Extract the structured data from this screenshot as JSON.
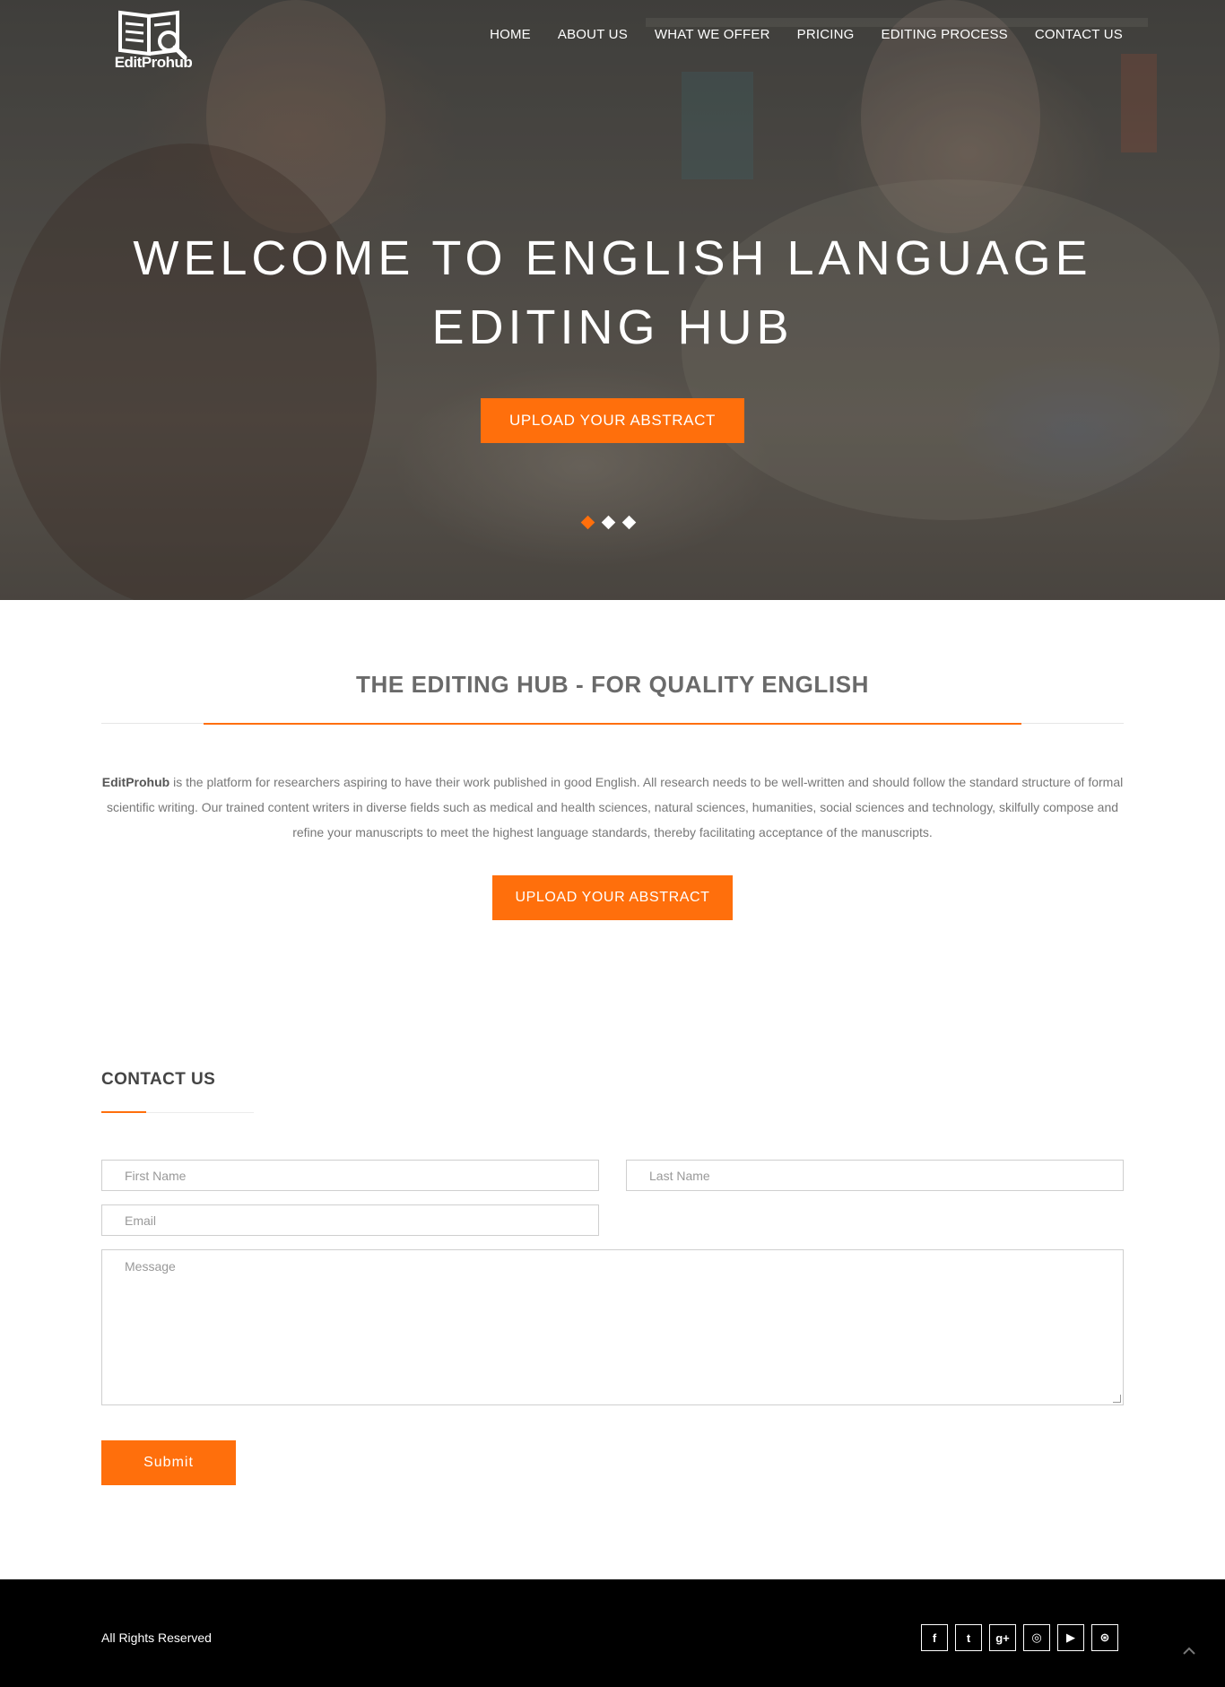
{
  "brand": {
    "name": "EditProhub"
  },
  "nav": {
    "items": [
      {
        "label": "HOME"
      },
      {
        "label": "ABOUT US"
      },
      {
        "label": "WHAT WE OFFER"
      },
      {
        "label": "PRICING"
      },
      {
        "label": "EDITING PROCESS"
      },
      {
        "label": "CONTACT US"
      }
    ]
  },
  "hero": {
    "title_line1": "WELCOME TO ENGLISH LANGUAGE",
    "title_line2": "EDITING HUB",
    "button_label": "UPLOAD YOUR ABSTRACT",
    "slides": {
      "count": 3,
      "active_index": 0
    }
  },
  "intro": {
    "title": "THE EDITING HUB - FOR QUALITY ENGLISH",
    "text_brand": "EditProhub",
    "text_body": " is the platform for researchers aspiring to have their work published in good English. All research needs to be well-written and should follow the standard structure of formal scientific writing. Our trained content writers in diverse fields such as medical and health sciences, natural sciences, humanities, social sciences and technology, skilfully compose and refine your manuscripts to meet the highest language standards, thereby facilitating acceptance of the manuscripts.",
    "button_label": "UPLOAD YOUR ABSTRACT"
  },
  "contact": {
    "title": "CONTACT US",
    "first_name_placeholder": "First Name",
    "last_name_placeholder": "Last Name",
    "email_placeholder": "Email",
    "message_placeholder": "Message",
    "submit_label": "Submit"
  },
  "footer": {
    "copyright": "All Rights Reserved",
    "socials": [
      {
        "icon": "facebook-icon",
        "glyph": "f"
      },
      {
        "icon": "twitter-icon",
        "glyph": "t"
      },
      {
        "icon": "google-plus-icon",
        "glyph": "g+"
      },
      {
        "icon": "instagram-icon",
        "glyph": "◎"
      },
      {
        "icon": "youtube-icon",
        "glyph": "▶"
      },
      {
        "icon": "dribbble-icon",
        "glyph": "⊛"
      }
    ]
  },
  "colors": {
    "accent": "#ff6f0c",
    "footer_bg": "#000000",
    "text": "#777777"
  }
}
